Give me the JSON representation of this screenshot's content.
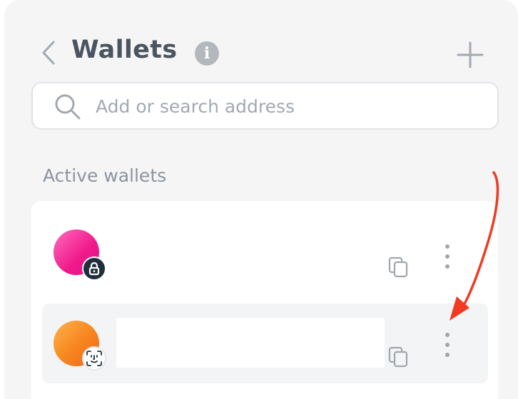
{
  "header": {
    "back_icon": "chevron-left-icon",
    "title": "Wallets",
    "info_icon": "info-icon",
    "info_glyph": "i",
    "add_icon": "plus-icon"
  },
  "search": {
    "placeholder": "Add or search address",
    "value": "",
    "icon": "search-icon"
  },
  "active_wallets": {
    "section_label": "Active wallets",
    "wallets": [
      {
        "name": "",
        "avatar_gradient": [
          "#ff6cbf",
          "#e0128a"
        ],
        "security_badge": "lock-icon",
        "actions": [
          "copy-icon",
          "more-vertical-icon"
        ]
      },
      {
        "name": "",
        "avatar_gradient": [
          "#ffb24a",
          "#e8661a"
        ],
        "security_badge": "face-id-icon",
        "actions": [
          "copy-icon",
          "more-vertical-icon"
        ],
        "highlighted": true
      }
    ]
  },
  "annotation": {
    "type": "arrow",
    "color": "#f03a22",
    "points_to": "wallet-2-more-button"
  },
  "colors": {
    "panel_bg": "#f5f5f6",
    "title_text": "#4a5560",
    "muted_text": "#8d949c",
    "placeholder_text": "#a3a9b1"
  }
}
